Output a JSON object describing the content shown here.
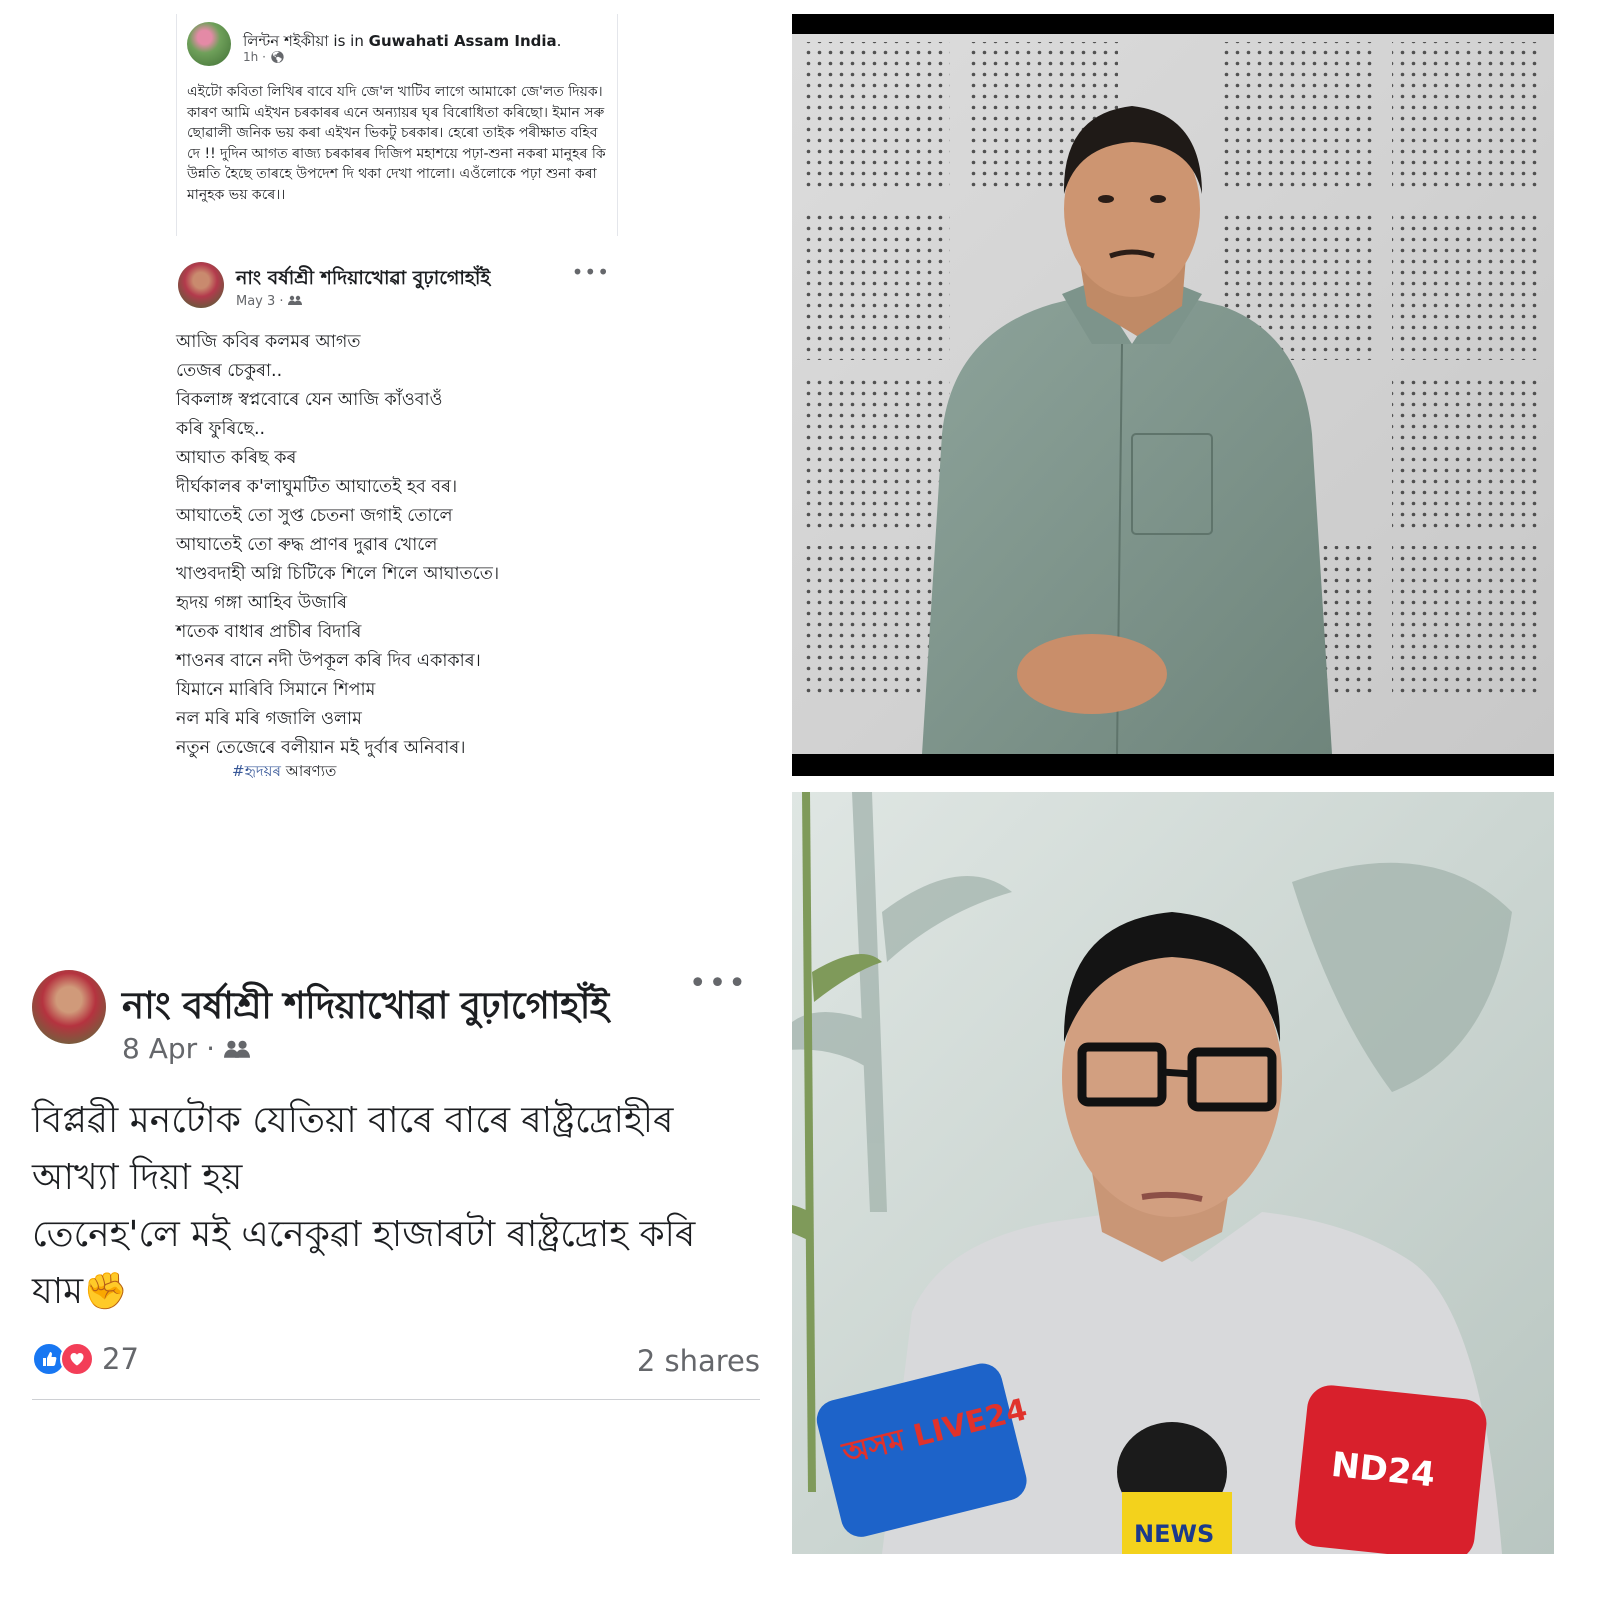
{
  "post1": {
    "author": "লিন্টন শইকীয়া",
    "is_in": "is in",
    "location": "Guwahati Assam India",
    "time": "1h",
    "body": "এইটো কবিতা লিখিৰ বাবে যদি জে'ল খাটিব লাগে আমাকো জে'লত দিয়ক। কাৰণ আমি এইখন চৰকাৰৰ এনে অন্যায়ৰ ঘৃৰ বিৰোধিতা কৰিছো। ইমান সৰু ছোৱালী জনিক ভয় কৰা এইখন ভিকটু চৰকাৰ। হেৰো তাইক পৰীক্ষাত বহিব দে !! দুদিন আগত ৰাজ্য চৰকাৰৰ দিজিপ মহাশয়ে পঢ়া-শুনা নকৰা মানুহৰ কি উন্নতি হৈছে তাৰহে উপদেশ দি থকা দেখা পালো। এওঁলোকে পঢ়া শুনা কৰা মানুহক ভয় কৰে।।"
  },
  "post2": {
    "author": "নাং বৰ্ষাশ্ৰী শদিয়াখোৱা বুঢ়াগোহাঁই",
    "date": "May 3",
    "more": "•••",
    "poem": [
      "আজি কবিৰ কলমৰ আগত",
      "তেজৰ চেকুৰা..",
      "বিকলাঙ্গ স্বপ্নবোৰে যেন আজি কাঁওবাওঁ",
      "কৰি ফুৰিছে..",
      "আঘাত কৰিছ কৰ",
      "দীৰ্ঘকালৰ ক'লাঘুমটিত আঘাতেই হব বৰ।",
      "আঘাতেই তো সুপ্ত চেতনা জগাই তোলে",
      "আঘাতেই তো ৰুদ্ধ প্ৰাণৰ দুৱাৰ খোলে",
      "খাণ্ডবদাহী অগ্নি চিটিকে শিলে শিলে আঘাততে।",
      "হৃদয় গঙ্গা আহিব উজাৰি",
      "শতেক বাধাৰ প্ৰাচীৰ বিদাৰি",
      "শাওনৰ বানে নদী উপকূল কৰি দিব একাকাৰ।",
      "যিমানে মাৰিবি সিমানে শিপাম",
      "নল মৰি মৰি গজালি ওলাম",
      "নতুন তেজেৰে বলীয়ান মই দুৰ্বাৰ অনিবাৰ।"
    ],
    "hashtag": "#হৃদয়ৰ",
    "hashtag_rest": "আৰণ্যত"
  },
  "post3": {
    "author": "নাং বৰ্ষাশ্ৰী শদিয়াখোৱা বুঢ়াগোহাঁই",
    "date": "8 Apr",
    "more": "•••",
    "body_lines": [
      "বিপ্লৱী মনটোক যেতিয়া বাৰে বাৰে ৰাষ্ট্ৰদ্ৰোহীৰ",
      "আখ্যা দিয়া হয়",
      "তেনেহ'লে মই এনেকুৱা হাজাৰটা ৰাষ্ট্ৰদ্ৰোহ কৰি",
      "যাম✊"
    ],
    "reaction_count": "27",
    "shares": "2 shares"
  },
  "photo2_mics": {
    "mic1": "অসম LIVE24",
    "mic2": "ND24",
    "mic3": "NEWS"
  },
  "colors": {
    "fb_text": "#1c1e21",
    "fb_meta": "#65676b",
    "like_blue": "#1877f2",
    "love_red": "#f33e58",
    "hashtag_blue": "#385898"
  }
}
